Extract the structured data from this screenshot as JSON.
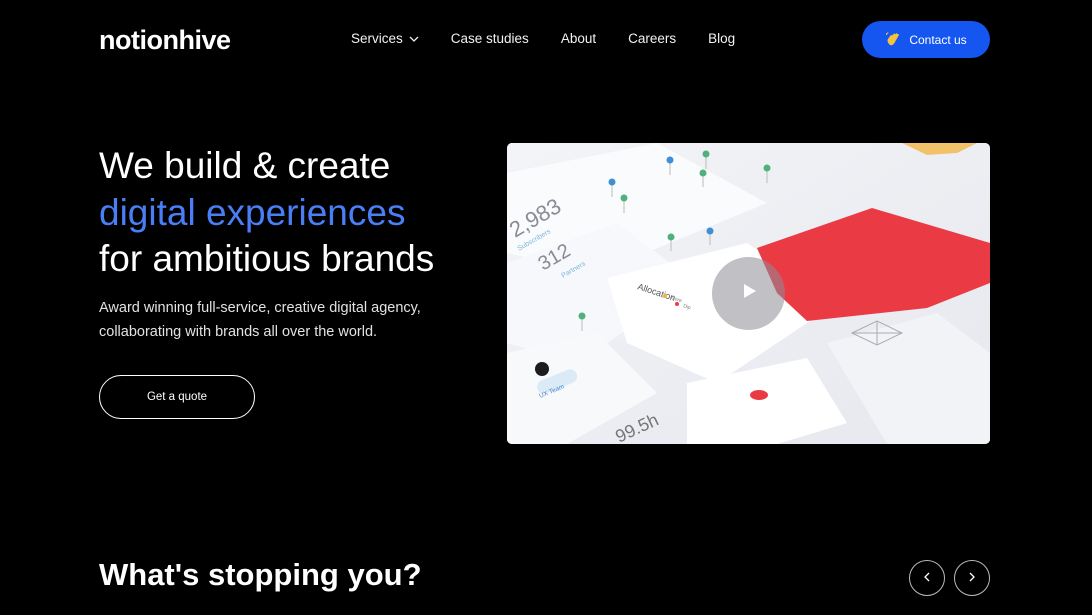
{
  "brand": {
    "logo_text": "notionhive"
  },
  "nav": {
    "items": [
      {
        "label": "Services",
        "has_dropdown": true
      },
      {
        "label": "Case studies"
      },
      {
        "label": "About"
      },
      {
        "label": "Careers"
      },
      {
        "label": "Blog"
      }
    ]
  },
  "contact": {
    "label": "Contact us",
    "icon": "waving-hand-icon"
  },
  "hero": {
    "title_line1": "We build & create",
    "title_accent": "digital experiences",
    "title_line3": "for ambitious brands",
    "subtitle_line1": "Award winning full-service, creative digital agency,",
    "subtitle_line2": "collaborating with brands all over the world.",
    "cta_label": "Get a quote"
  },
  "video": {
    "play_icon": "play-icon",
    "stat_1_value": "2,983",
    "stat_1_label": "Subscribers",
    "stat_2_value": "312",
    "stat_2_label": "Partners",
    "card_title": "Allocation",
    "card_item_1": "Core",
    "card_item_2": "Dip",
    "tag_label": "UX Team",
    "bottom_value": "99.5h"
  },
  "section": {
    "title": "What's stopping you?",
    "prev_icon": "chevron-left-icon",
    "next_icon": "chevron-right-icon"
  },
  "colors": {
    "background": "#000000",
    "accent_text": "#4a7ef7",
    "contact_button": "#1556f0",
    "video_red": "#ea3b45"
  }
}
